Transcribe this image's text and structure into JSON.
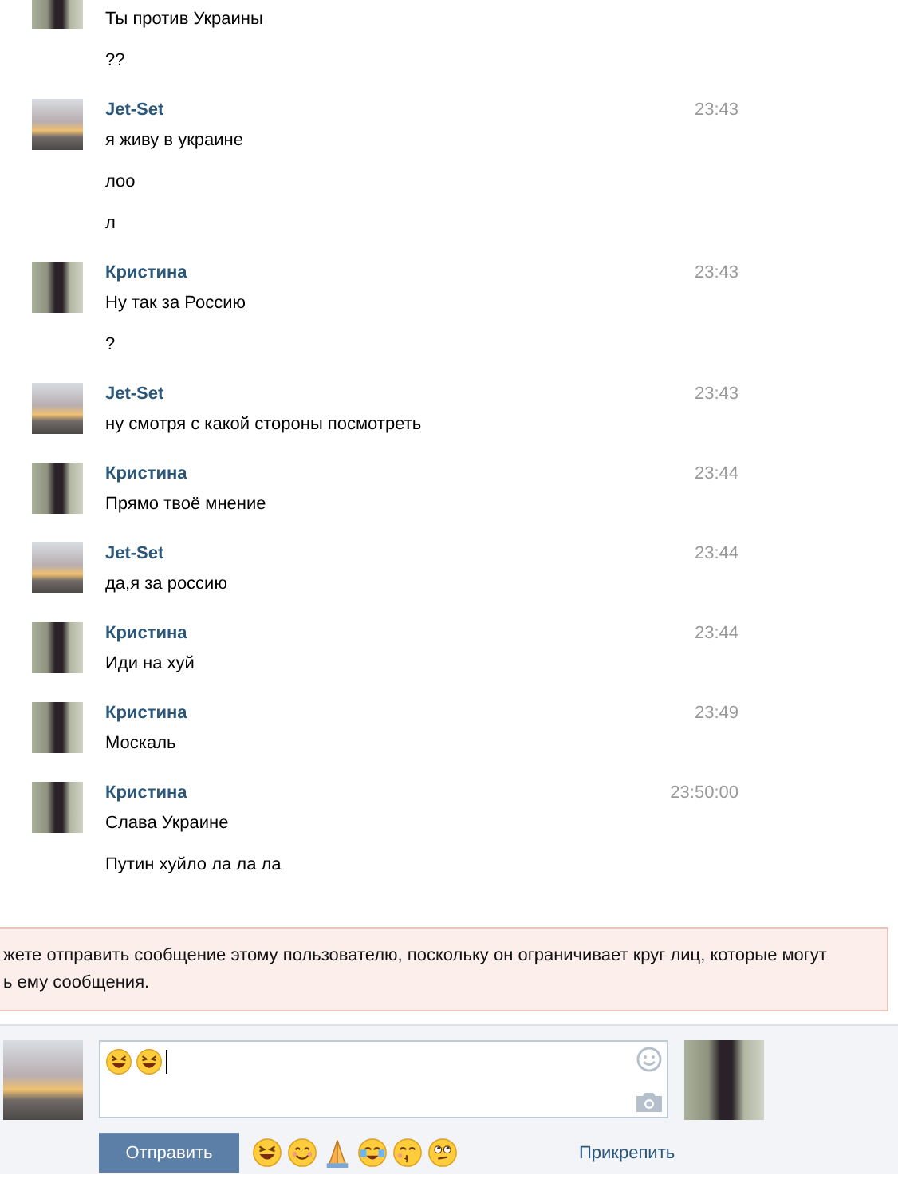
{
  "messages": [
    {
      "kind": "person",
      "lines": [
        "Ты против Украины",
        "??"
      ]
    },
    {
      "author": "Jet-Set",
      "kind": "sunset",
      "time": "23:43",
      "lines": [
        "я живу в украине",
        "лоо",
        "л"
      ]
    },
    {
      "author": "Кристина",
      "kind": "person",
      "time": "23:43",
      "lines": [
        "Ну так за Россию",
        "?"
      ]
    },
    {
      "author": "Jet-Set",
      "kind": "sunset",
      "time": "23:43",
      "lines": [
        "ну смотря с какой стороны посмотреть"
      ]
    },
    {
      "author": "Кристина",
      "kind": "person",
      "time": "23:44",
      "lines": [
        "Прямо твоё мнение"
      ]
    },
    {
      "author": "Jet-Set",
      "kind": "sunset",
      "time": "23:44",
      "lines": [
        "да,я за россию"
      ]
    },
    {
      "author": "Кристина",
      "kind": "person",
      "time": "23:44",
      "lines": [
        "Иди на хуй"
      ]
    },
    {
      "author": "Кристина",
      "kind": "person",
      "time": "23:49",
      "lines": [
        "Москаль"
      ]
    },
    {
      "author": "Кристина",
      "kind": "person",
      "time": "23:50:00",
      "lines": [
        "Слава Украине",
        "Путин хуйло ла ла ла"
      ]
    }
  ],
  "notice": {
    "lines": [
      "жете отправить сообщение этому пользователю, поскольку он ограничивает круг лиц, которые могут",
      "ь ему сообщения."
    ]
  },
  "composer": {
    "my_avatar": {
      "kind": "sunset"
    },
    "peer_avatar": {
      "kind": "person"
    },
    "field_emoji": [
      {
        "kind": "laugh"
      },
      {
        "kind": "laugh"
      }
    ],
    "send_button": "Отправить",
    "quick_emoji": [
      {
        "kind": "laugh"
      },
      {
        "kind": "smile"
      },
      {
        "kind": "pray"
      },
      {
        "kind": "tears"
      },
      {
        "kind": "kiss"
      },
      {
        "kind": "rolleyes"
      }
    ],
    "attach_link": "Прикрепить"
  }
}
